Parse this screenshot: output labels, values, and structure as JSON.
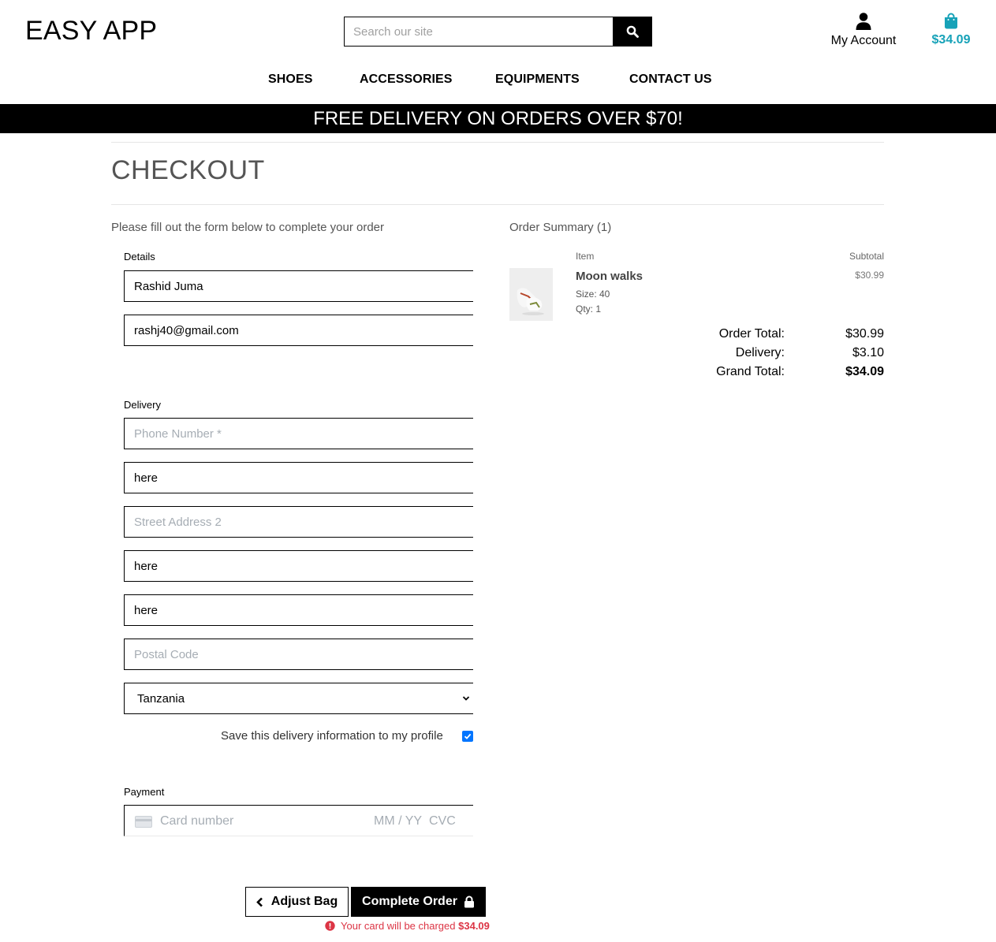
{
  "header": {
    "logo": "EASY APP",
    "search_placeholder": "Search our site",
    "account_label": "My Account",
    "bag_total": "$34.09",
    "accent_color": "#17a2b8"
  },
  "nav": {
    "items": [
      "SHOES",
      "ACCESSORIES",
      "EQUIPMENTS",
      "CONTACT US"
    ]
  },
  "banner": "FREE DELIVERY ON ORDERS OVER $70!",
  "page_title": "CHECKOUT",
  "form": {
    "intro": "Please fill out the form below to complete your order",
    "details_legend": "Details",
    "full_name": "Rashid Juma",
    "email": "rashj40@gmail.com",
    "delivery_legend": "Delivery",
    "phone_placeholder": "Phone Number *",
    "street1": "here",
    "street2_placeholder": "Street Address 2",
    "town": "here",
    "county": "here",
    "postcode_placeholder": "Postal Code",
    "country": "Tanzania",
    "save_info_label": "Save this delivery information to my profile",
    "save_info_checked": true,
    "payment_legend": "Payment",
    "card_placeholder": "Card number",
    "card_expiry_placeholder": "MM / YY",
    "card_cvc_placeholder": "CVC",
    "adjust_bag_label": "Adjust Bag",
    "complete_order_label": "Complete Order",
    "charge_notice": "Your card will be charged",
    "charge_amount": "$34.09",
    "error_color": "#dc3545"
  },
  "summary": {
    "title": "Order Summary (1)",
    "col_item": "Item",
    "col_subtotal": "Subtotal",
    "product": {
      "name": "Moon walks",
      "size": "Size: 40",
      "qty": "Qty: 1",
      "subtotal": "$30.99"
    },
    "order_total_label": "Order Total:",
    "order_total": "$30.99",
    "delivery_label": "Delivery:",
    "delivery": "$3.10",
    "grand_total_label": "Grand Total:",
    "grand_total": "$34.09"
  }
}
